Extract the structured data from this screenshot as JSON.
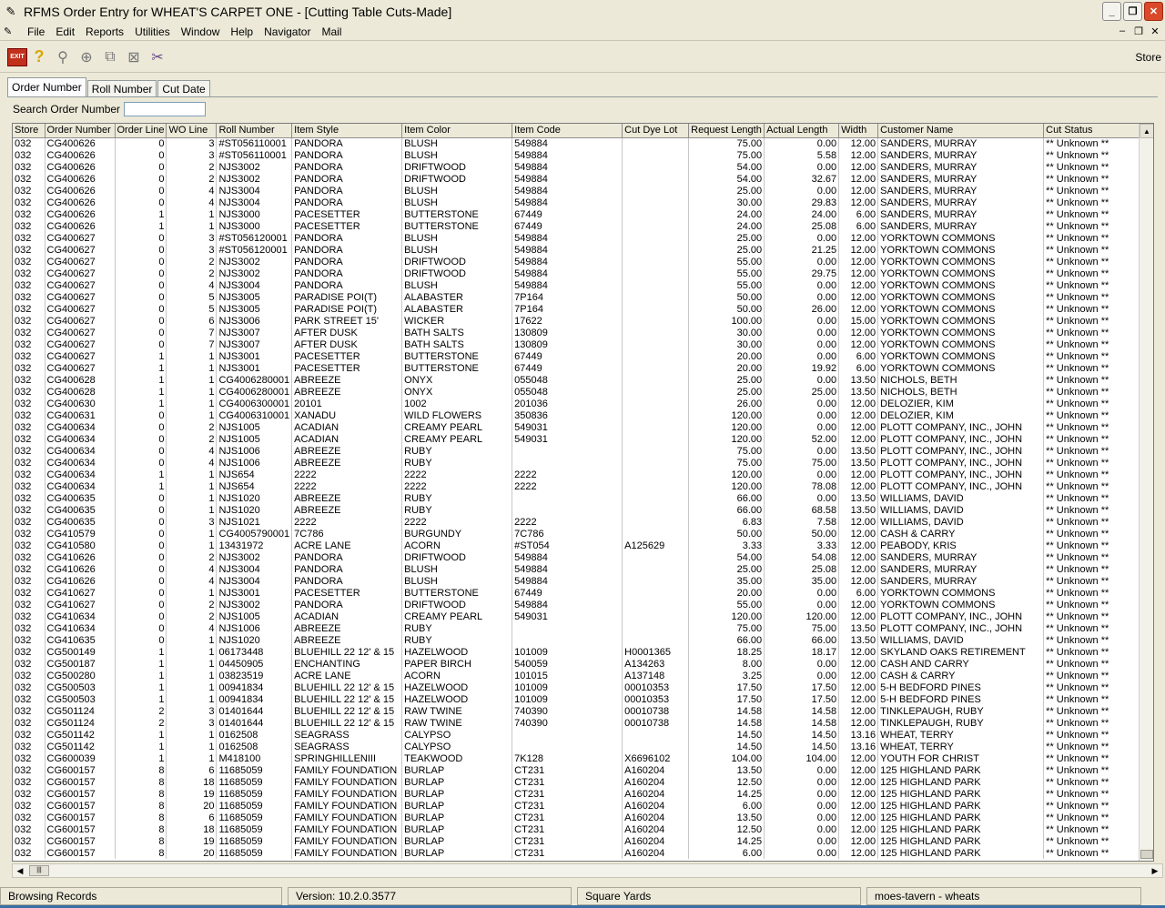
{
  "window": {
    "title": "RFMS Order Entry for WHEAT'S CARPET ONE - [Cutting Table Cuts-Made]",
    "minimize": "_",
    "restore": "❐",
    "close": "✕"
  },
  "menu": [
    "File",
    "Edit",
    "Reports",
    "Utilities",
    "Window",
    "Help",
    "Navigator",
    "Mail"
  ],
  "mdi": {
    "minimize": "–",
    "restore": "❐",
    "close": "✕"
  },
  "toolbar": {
    "exit_label": "EXIT",
    "help_icon": "?",
    "store_label": "Store"
  },
  "tabs": [
    "Order Number",
    "Roll Number",
    "Cut Date"
  ],
  "search": {
    "label": "Search Order Number",
    "value": ""
  },
  "columns": [
    "Store",
    "Order Number",
    "Order Line",
    "WO Line",
    "Roll Number",
    "Item Style",
    "Item Color",
    "Item Code",
    "Cut Dye Lot",
    "Request Length",
    "Actual Length",
    "Width",
    "Customer Name",
    "Cut Status"
  ],
  "rows": [
    [
      "032",
      "CG400626",
      "0",
      "3",
      "#ST056110001",
      "PANDORA",
      "BLUSH",
      "549884",
      "",
      "75.00",
      "0.00",
      "12.00",
      "SANDERS, MURRAY",
      "** Unknown **"
    ],
    [
      "032",
      "CG400626",
      "0",
      "3",
      "#ST056110001",
      "PANDORA",
      "BLUSH",
      "549884",
      "",
      "75.00",
      "5.58",
      "12.00",
      "SANDERS, MURRAY",
      "** Unknown **"
    ],
    [
      "032",
      "CG400626",
      "0",
      "2",
      "NJS3002",
      "PANDORA",
      "DRIFTWOOD",
      "549884",
      "",
      "54.00",
      "0.00",
      "12.00",
      "SANDERS, MURRAY",
      "** Unknown **"
    ],
    [
      "032",
      "CG400626",
      "0",
      "2",
      "NJS3002",
      "PANDORA",
      "DRIFTWOOD",
      "549884",
      "",
      "54.00",
      "32.67",
      "12.00",
      "SANDERS, MURRAY",
      "** Unknown **"
    ],
    [
      "032",
      "CG400626",
      "0",
      "4",
      "NJS3004",
      "PANDORA",
      "BLUSH",
      "549884",
      "",
      "25.00",
      "0.00",
      "12.00",
      "SANDERS, MURRAY",
      "** Unknown **"
    ],
    [
      "032",
      "CG400626",
      "0",
      "4",
      "NJS3004",
      "PANDORA",
      "BLUSH",
      "549884",
      "",
      "30.00",
      "29.83",
      "12.00",
      "SANDERS, MURRAY",
      "** Unknown **"
    ],
    [
      "032",
      "CG400626",
      "1",
      "1",
      "NJS3000",
      "PACESETTER",
      "BUTTERSTONE",
      "67449",
      "",
      "24.00",
      "24.00",
      "6.00",
      "SANDERS, MURRAY",
      "** Unknown **"
    ],
    [
      "032",
      "CG400626",
      "1",
      "1",
      "NJS3000",
      "PACESETTER",
      "BUTTERSTONE",
      "67449",
      "",
      "24.00",
      "25.08",
      "6.00",
      "SANDERS, MURRAY",
      "** Unknown **"
    ],
    [
      "032",
      "CG400627",
      "0",
      "3",
      "#ST056120001",
      "PANDORA",
      "BLUSH",
      "549884",
      "",
      "25.00",
      "0.00",
      "12.00",
      "YORKTOWN COMMONS",
      "** Unknown **"
    ],
    [
      "032",
      "CG400627",
      "0",
      "3",
      "#ST056120001",
      "PANDORA",
      "BLUSH",
      "549884",
      "",
      "25.00",
      "21.25",
      "12.00",
      "YORKTOWN COMMONS",
      "** Unknown **"
    ],
    [
      "032",
      "CG400627",
      "0",
      "2",
      "NJS3002",
      "PANDORA",
      "DRIFTWOOD",
      "549884",
      "",
      "55.00",
      "0.00",
      "12.00",
      "YORKTOWN COMMONS",
      "** Unknown **"
    ],
    [
      "032",
      "CG400627",
      "0",
      "2",
      "NJS3002",
      "PANDORA",
      "DRIFTWOOD",
      "549884",
      "",
      "55.00",
      "29.75",
      "12.00",
      "YORKTOWN COMMONS",
      "** Unknown **"
    ],
    [
      "032",
      "CG400627",
      "0",
      "4",
      "NJS3004",
      "PANDORA",
      "BLUSH",
      "549884",
      "",
      "55.00",
      "0.00",
      "12.00",
      "YORKTOWN COMMONS",
      "** Unknown **"
    ],
    [
      "032",
      "CG400627",
      "0",
      "5",
      "NJS3005",
      "PARADISE POI(T)",
      "ALABASTER",
      "7P164",
      "",
      "50.00",
      "0.00",
      "12.00",
      "YORKTOWN COMMONS",
      "** Unknown **"
    ],
    [
      "032",
      "CG400627",
      "0",
      "5",
      "NJS3005",
      "PARADISE POI(T)",
      "ALABASTER",
      "7P164",
      "",
      "50.00",
      "26.00",
      "12.00",
      "YORKTOWN COMMONS",
      "** Unknown **"
    ],
    [
      "032",
      "CG400627",
      "0",
      "6",
      "NJS3006",
      "PARK STREET 15'",
      "WICKER",
      "17622",
      "",
      "100.00",
      "0.00",
      "15.00",
      "YORKTOWN COMMONS",
      "** Unknown **"
    ],
    [
      "032",
      "CG400627",
      "0",
      "7",
      "NJS3007",
      "AFTER DUSK",
      "BATH SALTS",
      "130809",
      "",
      "30.00",
      "0.00",
      "12.00",
      "YORKTOWN COMMONS",
      "** Unknown **"
    ],
    [
      "032",
      "CG400627",
      "0",
      "7",
      "NJS3007",
      "AFTER DUSK",
      "BATH SALTS",
      "130809",
      "",
      "30.00",
      "0.00",
      "12.00",
      "YORKTOWN COMMONS",
      "** Unknown **"
    ],
    [
      "032",
      "CG400627",
      "1",
      "1",
      "NJS3001",
      "PACESETTER",
      "BUTTERSTONE",
      "67449",
      "",
      "20.00",
      "0.00",
      "6.00",
      "YORKTOWN COMMONS",
      "** Unknown **"
    ],
    [
      "032",
      "CG400627",
      "1",
      "1",
      "NJS3001",
      "PACESETTER",
      "BUTTERSTONE",
      "67449",
      "",
      "20.00",
      "19.92",
      "6.00",
      "YORKTOWN COMMONS",
      "** Unknown **"
    ],
    [
      "032",
      "CG400628",
      "1",
      "1",
      "CG4006280001",
      "ABREEZE",
      "ONYX",
      "055048",
      "",
      "25.00",
      "0.00",
      "13.50",
      "NICHOLS, BETH",
      "** Unknown **"
    ],
    [
      "032",
      "CG400628",
      "1",
      "1",
      "CG4006280001",
      "ABREEZE",
      "ONYX",
      "055048",
      "",
      "25.00",
      "25.00",
      "13.50",
      "NICHOLS, BETH",
      "** Unknown **"
    ],
    [
      "032",
      "CG400630",
      "1",
      "1",
      "CG4006300001",
      "20101",
      "1002",
      "201036",
      "",
      "26.00",
      "0.00",
      "12.00",
      "DELOZIER, KIM",
      "** Unknown **"
    ],
    [
      "032",
      "CG400631",
      "0",
      "1",
      "CG4006310001",
      "XANADU",
      "WILD FLOWERS",
      "350836",
      "",
      "120.00",
      "0.00",
      "12.00",
      "DELOZIER, KIM",
      "** Unknown **"
    ],
    [
      "032",
      "CG400634",
      "0",
      "2",
      "NJS1005",
      "ACADIAN",
      "CREAMY PEARL",
      "549031",
      "",
      "120.00",
      "0.00",
      "12.00",
      "PLOTT COMPANY, INC., JOHN",
      "** Unknown **"
    ],
    [
      "032",
      "CG400634",
      "0",
      "2",
      "NJS1005",
      "ACADIAN",
      "CREAMY PEARL",
      "549031",
      "",
      "120.00",
      "52.00",
      "12.00",
      "PLOTT COMPANY, INC., JOHN",
      "** Unknown **"
    ],
    [
      "032",
      "CG400634",
      "0",
      "4",
      "NJS1006",
      "ABREEZE",
      "RUBY",
      "",
      "",
      "75.00",
      "0.00",
      "13.50",
      "PLOTT COMPANY, INC., JOHN",
      "** Unknown **"
    ],
    [
      "032",
      "CG400634",
      "0",
      "4",
      "NJS1006",
      "ABREEZE",
      "RUBY",
      "",
      "",
      "75.00",
      "75.00",
      "13.50",
      "PLOTT COMPANY, INC., JOHN",
      "** Unknown **"
    ],
    [
      "032",
      "CG400634",
      "1",
      "1",
      "NJS654",
      "2222",
      "2222",
      "2222",
      "",
      "120.00",
      "0.00",
      "12.00",
      "PLOTT COMPANY, INC., JOHN",
      "** Unknown **"
    ],
    [
      "032",
      "CG400634",
      "1",
      "1",
      "NJS654",
      "2222",
      "2222",
      "2222",
      "",
      "120.00",
      "78.08",
      "12.00",
      "PLOTT COMPANY, INC., JOHN",
      "** Unknown **"
    ],
    [
      "032",
      "CG400635",
      "0",
      "1",
      "NJS1020",
      "ABREEZE",
      "RUBY",
      "",
      "",
      "66.00",
      "0.00",
      "13.50",
      "WILLIAMS, DAVID",
      "** Unknown **"
    ],
    [
      "032",
      "CG400635",
      "0",
      "1",
      "NJS1020",
      "ABREEZE",
      "RUBY",
      "",
      "",
      "66.00",
      "68.58",
      "13.50",
      "WILLIAMS, DAVID",
      "** Unknown **"
    ],
    [
      "032",
      "CG400635",
      "0",
      "3",
      "NJS1021",
      "2222",
      "2222",
      "2222",
      "",
      "6.83",
      "7.58",
      "12.00",
      "WILLIAMS, DAVID",
      "** Unknown **"
    ],
    [
      "032",
      "CG410579",
      "0",
      "1",
      "CG4005790001",
      "7C786",
      "BURGUNDY",
      "7C786",
      "",
      "50.00",
      "50.00",
      "12.00",
      "CASH & CARRY",
      "** Unknown **"
    ],
    [
      "032",
      "CG410580",
      "0",
      "1",
      "13431972",
      "ACRE LANE",
      "ACORN",
      "#ST054",
      "A125629",
      "3.33",
      "3.33",
      "12.00",
      "PEABODY, KRIS",
      "** Unknown **"
    ],
    [
      "032",
      "CG410626",
      "0",
      "2",
      "NJS3002",
      "PANDORA",
      "DRIFTWOOD",
      "549884",
      "",
      "54.00",
      "54.08",
      "12.00",
      "SANDERS, MURRAY",
      "** Unknown **"
    ],
    [
      "032",
      "CG410626",
      "0",
      "4",
      "NJS3004",
      "PANDORA",
      "BLUSH",
      "549884",
      "",
      "25.00",
      "25.08",
      "12.00",
      "SANDERS, MURRAY",
      "** Unknown **"
    ],
    [
      "032",
      "CG410626",
      "0",
      "4",
      "NJS3004",
      "PANDORA",
      "BLUSH",
      "549884",
      "",
      "35.00",
      "35.00",
      "12.00",
      "SANDERS, MURRAY",
      "** Unknown **"
    ],
    [
      "032",
      "CG410627",
      "0",
      "1",
      "NJS3001",
      "PACESETTER",
      "BUTTERSTONE",
      "67449",
      "",
      "20.00",
      "0.00",
      "6.00",
      "YORKTOWN COMMONS",
      "** Unknown **"
    ],
    [
      "032",
      "CG410627",
      "0",
      "2",
      "NJS3002",
      "PANDORA",
      "DRIFTWOOD",
      "549884",
      "",
      "55.00",
      "0.00",
      "12.00",
      "YORKTOWN COMMONS",
      "** Unknown **"
    ],
    [
      "032",
      "CG410634",
      "0",
      "2",
      "NJS1005",
      "ACADIAN",
      "CREAMY PEARL",
      "549031",
      "",
      "120.00",
      "120.00",
      "12.00",
      "PLOTT COMPANY, INC., JOHN",
      "** Unknown **"
    ],
    [
      "032",
      "CG410634",
      "0",
      "4",
      "NJS1006",
      "ABREEZE",
      "RUBY",
      "",
      "",
      "75.00",
      "75.00",
      "13.50",
      "PLOTT COMPANY, INC., JOHN",
      "** Unknown **"
    ],
    [
      "032",
      "CG410635",
      "0",
      "1",
      "NJS1020",
      "ABREEZE",
      "RUBY",
      "",
      "",
      "66.00",
      "66.00",
      "13.50",
      "WILLIAMS, DAVID",
      "** Unknown **"
    ],
    [
      "032",
      "CG500149",
      "1",
      "1",
      "06173448",
      "BLUEHILL 22 12' & 15",
      "HAZELWOOD",
      "101009",
      "H0001365",
      "18.25",
      "18.17",
      "12.00",
      "SKYLAND OAKS RETIREMENT",
      "** Unknown **"
    ],
    [
      "032",
      "CG500187",
      "1",
      "1",
      "04450905",
      "ENCHANTING",
      "PAPER BIRCH",
      "540059",
      "A134263",
      "8.00",
      "0.00",
      "12.00",
      "CASH AND CARRY",
      "** Unknown **"
    ],
    [
      "032",
      "CG500280",
      "1",
      "1",
      "03823519",
      "ACRE LANE",
      "ACORN",
      "101015",
      "A137148",
      "3.25",
      "0.00",
      "12.00",
      "CASH & CARRY",
      "** Unknown **"
    ],
    [
      "032",
      "CG500503",
      "1",
      "1",
      "00941834",
      "BLUEHILL 22 12' & 15",
      "HAZELWOOD",
      "101009",
      "00010353",
      "17.50",
      "17.50",
      "12.00",
      "5-H BEDFORD PINES",
      "** Unknown **"
    ],
    [
      "032",
      "CG500503",
      "1",
      "1",
      "00941834",
      "BLUEHILL 22 12' & 15",
      "HAZELWOOD",
      "101009",
      "00010353",
      "17.50",
      "17.50",
      "12.00",
      "5-H BEDFORD PINES",
      "** Unknown **"
    ],
    [
      "032",
      "CG501124",
      "2",
      "3",
      "01401644",
      "BLUEHILL 22 12' & 15",
      "RAW TWINE",
      "740390",
      "00010738",
      "14.58",
      "14.58",
      "12.00",
      "TINKLEPAUGH, RUBY",
      "** Unknown **"
    ],
    [
      "032",
      "CG501124",
      "2",
      "3",
      "01401644",
      "BLUEHILL 22 12' & 15",
      "RAW TWINE",
      "740390",
      "00010738",
      "14.58",
      "14.58",
      "12.00",
      "TINKLEPAUGH, RUBY",
      "** Unknown **"
    ],
    [
      "032",
      "CG501142",
      "1",
      "1",
      "0162508",
      "SEAGRASS",
      "CALYPSO",
      "",
      "",
      "14.50",
      "14.50",
      "13.16",
      "WHEAT, TERRY",
      "** Unknown **"
    ],
    [
      "032",
      "CG501142",
      "1",
      "1",
      "0162508",
      "SEAGRASS",
      "CALYPSO",
      "",
      "",
      "14.50",
      "14.50",
      "13.16",
      "WHEAT, TERRY",
      "** Unknown **"
    ],
    [
      "032",
      "CG600039",
      "1",
      "1",
      "M418100",
      "SPRINGHILLENIII",
      "TEAKWOOD",
      "7K128",
      "X6696102",
      "104.00",
      "104.00",
      "12.00",
      "YOUTH FOR CHRIST",
      "** Unknown **"
    ],
    [
      "032",
      "CG600157",
      "8",
      "6",
      "11685059",
      "FAMILY FOUNDATION",
      "BURLAP",
      "CT231",
      "A160204",
      "13.50",
      "0.00",
      "12.00",
      "125 HIGHLAND PARK",
      "** Unknown **"
    ],
    [
      "032",
      "CG600157",
      "8",
      "18",
      "11685059",
      "FAMILY FOUNDATION",
      "BURLAP",
      "CT231",
      "A160204",
      "12.50",
      "0.00",
      "12.00",
      "125 HIGHLAND PARK",
      "** Unknown **"
    ],
    [
      "032",
      "CG600157",
      "8",
      "19",
      "11685059",
      "FAMILY FOUNDATION",
      "BURLAP",
      "CT231",
      "A160204",
      "14.25",
      "0.00",
      "12.00",
      "125 HIGHLAND PARK",
      "** Unknown **"
    ],
    [
      "032",
      "CG600157",
      "8",
      "20",
      "11685059",
      "FAMILY FOUNDATION",
      "BURLAP",
      "CT231",
      "A160204",
      "6.00",
      "0.00",
      "12.00",
      "125 HIGHLAND PARK",
      "** Unknown **"
    ],
    [
      "032",
      "CG600157",
      "8",
      "6",
      "11685059",
      "FAMILY FOUNDATION",
      "BURLAP",
      "CT231",
      "A160204",
      "13.50",
      "0.00",
      "12.00",
      "125 HIGHLAND PARK",
      "** Unknown **"
    ],
    [
      "032",
      "CG600157",
      "8",
      "18",
      "11685059",
      "FAMILY FOUNDATION",
      "BURLAP",
      "CT231",
      "A160204",
      "12.50",
      "0.00",
      "12.00",
      "125 HIGHLAND PARK",
      "** Unknown **"
    ],
    [
      "032",
      "CG600157",
      "8",
      "19",
      "11685059",
      "FAMILY FOUNDATION",
      "BURLAP",
      "CT231",
      "A160204",
      "14.25",
      "0.00",
      "12.00",
      "125 HIGHLAND PARK",
      "** Unknown **"
    ],
    [
      "032",
      "CG600157",
      "8",
      "20",
      "11685059",
      "FAMILY FOUNDATION",
      "BURLAP",
      "CT231",
      "A160204",
      "6.00",
      "0.00",
      "12.00",
      "125 HIGHLAND PARK",
      "** Unknown **"
    ]
  ],
  "selected_row": 61,
  "status": {
    "mode": "Browsing Records",
    "version": "Version: 10.2.0.3577",
    "units": "Square Yards",
    "server": "moes-tavern - wheats"
  },
  "colors": {
    "background": "#ece9d8",
    "selected_row": "#c0c0c0",
    "close_button": "#d9492a"
  }
}
